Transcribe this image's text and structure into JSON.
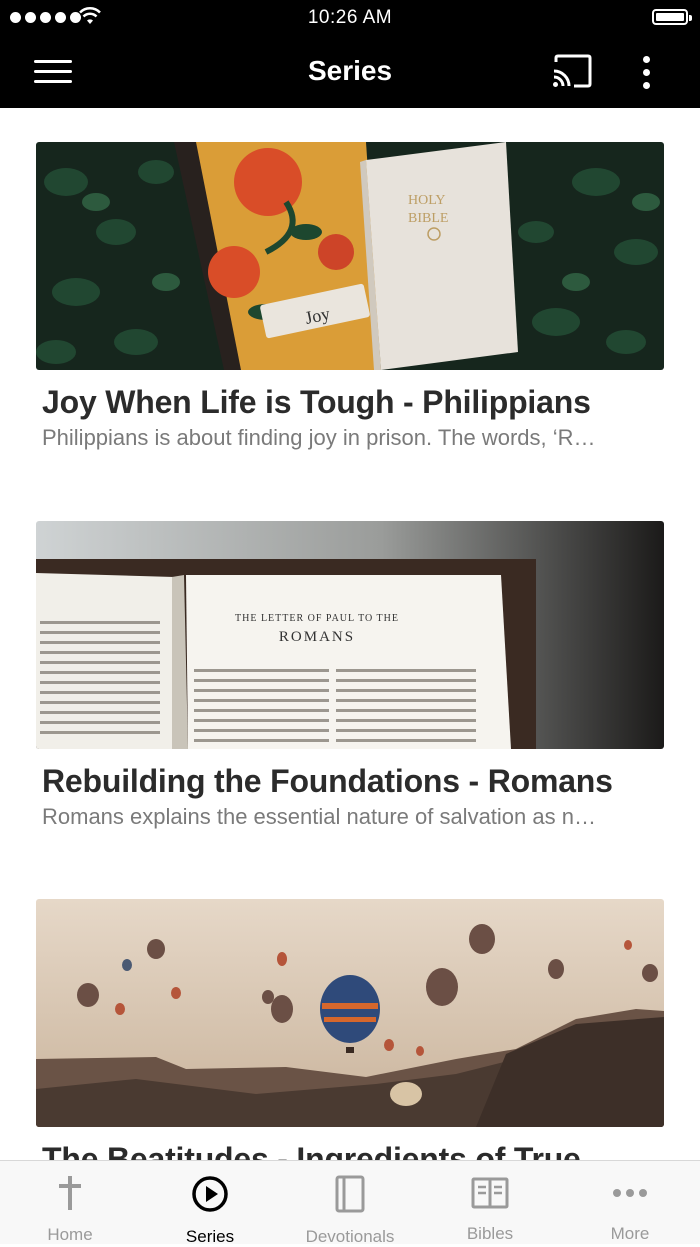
{
  "status_bar": {
    "time": "10:26 AM"
  },
  "nav": {
    "title": "Series"
  },
  "series": [
    {
      "title": "Joy When Life is Tough - Philippians",
      "description": "Philippians is about finding joy in prison. The words, ‘R…",
      "image": "joy-bible-notebook-image"
    },
    {
      "title": "Rebuilding the Foundations - Romans",
      "description": "Romans explains the essential nature of salvation as n…",
      "image": "romans-bible-image",
      "image_text": {
        "heading": "THE LETTER OF PAUL TO THE",
        "book": "ROMANS"
      }
    },
    {
      "title": "The Beatitudes - Ingredients of True",
      "description": "",
      "image": "hot-air-balloons-image"
    }
  ],
  "tabs": [
    {
      "label": "Home",
      "icon": "cross-icon",
      "active": false
    },
    {
      "label": "Series",
      "icon": "play-circle-icon",
      "active": true
    },
    {
      "label": "Devotionals",
      "icon": "book-icon",
      "active": false
    },
    {
      "label": "Bibles",
      "icon": "open-book-icon",
      "active": false
    },
    {
      "label": "More",
      "icon": "more-dots-icon",
      "active": false
    }
  ],
  "colors": {
    "bar": "#000000",
    "tab_active": "#000000",
    "tab_inactive": "#9a9a9a",
    "title": "#2b2b2b",
    "desc": "#7a7a7a"
  }
}
